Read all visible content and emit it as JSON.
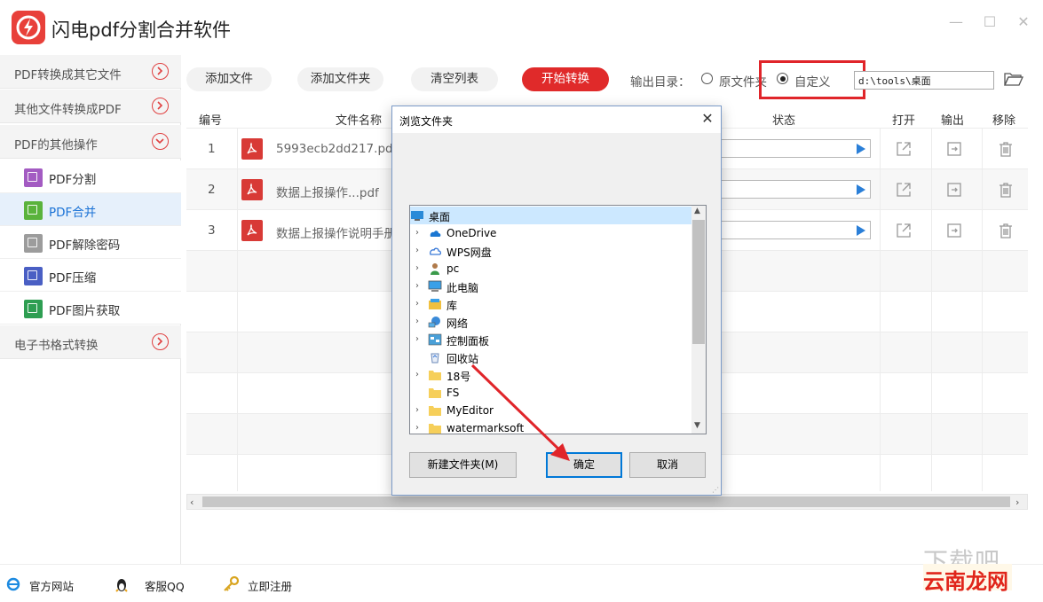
{
  "app": {
    "title": "闪电pdf分割合并软件",
    "accent_color": "#e02a2a",
    "window_controls": [
      "minimize-icon",
      "maximize-icon",
      "close-icon"
    ]
  },
  "sidebar": {
    "categories": [
      {
        "label": "PDF转换成其它文件",
        "state": "collapsed"
      },
      {
        "label": "其他文件转换成PDF",
        "state": "collapsed"
      },
      {
        "label": "PDF的其他操作",
        "state": "expanded"
      },
      {
        "label": "电子书格式转换",
        "state": "collapsed"
      }
    ],
    "items": [
      {
        "label": "PDF分割",
        "color": "#a35bc2",
        "active": false
      },
      {
        "label": "PDF合并",
        "color": "#5ab33c",
        "active": true
      },
      {
        "label": "PDF解除密码",
        "color": "#9c9c9c",
        "active": false
      },
      {
        "label": "PDF压缩",
        "color": "#4a5fc4",
        "active": false
      },
      {
        "label": "PDF图片获取",
        "color": "#2e9e52",
        "active": false
      }
    ]
  },
  "toolbar": {
    "add_file": "添加文件",
    "add_folder": "添加文件夹",
    "clear_list": "清空列表",
    "start": "开始转换",
    "output_label": "输出目录：",
    "option_original": "原文件夹",
    "option_custom": "自定义",
    "selected_option": "自定义",
    "output_path": "d:\\tools\\桌面"
  },
  "table": {
    "headers": {
      "num": "编号",
      "name": "文件名称",
      "status": "状态",
      "open": "打开",
      "output": "输出",
      "remove": "移除"
    },
    "rows": [
      {
        "num": "1",
        "name": "5993ecb2dd217.pdf"
      },
      {
        "num": "2",
        "name": "数据上报操作...pdf"
      },
      {
        "num": "3",
        "name": "数据上报操作说明手册"
      }
    ]
  },
  "footer": {
    "website": "官方网站",
    "service": "客服QQ",
    "register": "立即注册"
  },
  "watermark": {
    "text": "下载吧",
    "site": "云南龙网"
  },
  "dialog": {
    "title": "浏览文件夹",
    "tree": [
      {
        "label": "桌面",
        "icon": "desktop-icon",
        "expandable": false,
        "selected": true,
        "indent": 0
      },
      {
        "label": "OneDrive",
        "icon": "cloud-icon",
        "expandable": true,
        "selected": false,
        "indent": 1
      },
      {
        "label": "WPS网盘",
        "icon": "cloud-outline-icon",
        "expandable": true,
        "selected": false,
        "indent": 1
      },
      {
        "label": "pc",
        "icon": "user-icon",
        "expandable": true,
        "selected": false,
        "indent": 1
      },
      {
        "label": "此电脑",
        "icon": "computer-icon",
        "expandable": true,
        "selected": false,
        "indent": 1
      },
      {
        "label": "库",
        "icon": "library-icon",
        "expandable": true,
        "selected": false,
        "indent": 1
      },
      {
        "label": "网络",
        "icon": "network-icon",
        "expandable": true,
        "selected": false,
        "indent": 1
      },
      {
        "label": "控制面板",
        "icon": "control-panel-icon",
        "expandable": true,
        "selected": false,
        "indent": 1
      },
      {
        "label": "回收站",
        "icon": "recycle-bin-icon",
        "expandable": false,
        "selected": false,
        "indent": 1
      },
      {
        "label": "18号",
        "icon": "folder-icon",
        "expandable": true,
        "selected": false,
        "indent": 1
      },
      {
        "label": "FS",
        "icon": "folder-icon",
        "expandable": false,
        "selected": false,
        "indent": 1
      },
      {
        "label": "MyEditor",
        "icon": "folder-icon",
        "expandable": true,
        "selected": false,
        "indent": 1
      },
      {
        "label": "watermarksoft",
        "icon": "folder-icon",
        "expandable": true,
        "selected": false,
        "indent": 1
      }
    ],
    "new_folder": "新建文件夹(M)",
    "ok": "确定",
    "cancel": "取消"
  }
}
